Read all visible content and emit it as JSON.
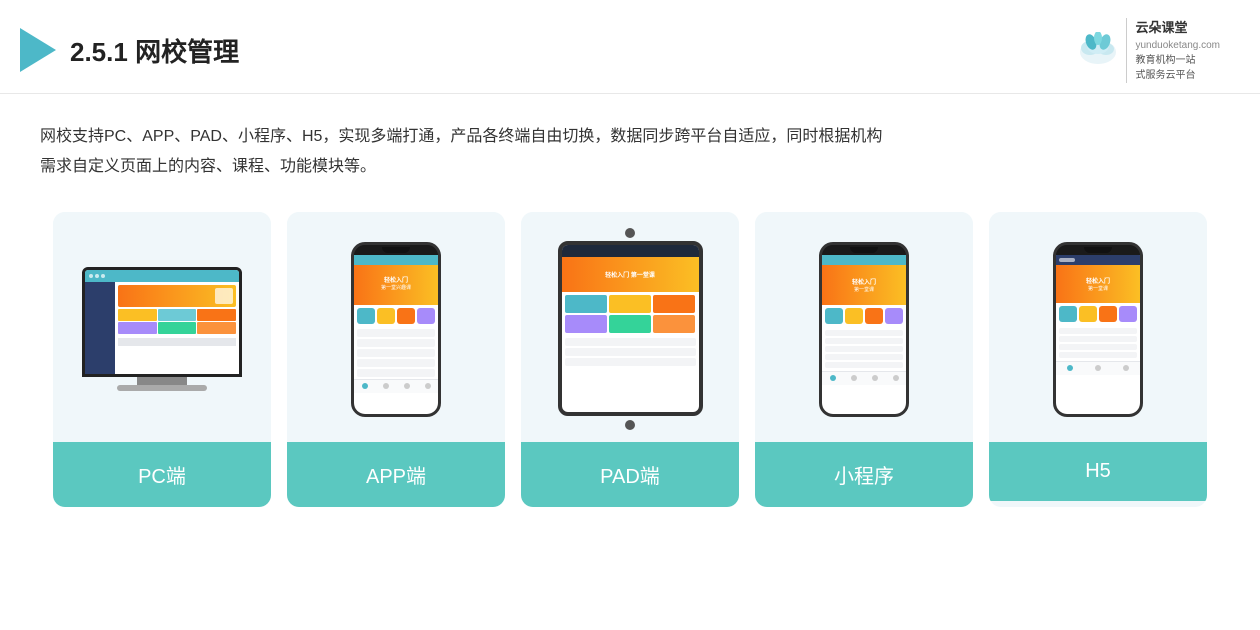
{
  "header": {
    "title_prefix": "2.5.1 ",
    "title_bold": "网校管理",
    "brand_name": "云朵课堂",
    "brand_url": "yunduoketang.com",
    "brand_slogan_line1": "教育机构一站",
    "brand_slogan_line2": "式服务云平台"
  },
  "description": {
    "line1": "网校支持PC、APP、PAD、小程序、H5，实现多端打通，产品各终端自由切换，数据同步跨平台自适应，同时根据机构",
    "line2": "需求自定义页面上的内容、课程、功能模块等。"
  },
  "cards": [
    {
      "id": "pc",
      "label": "PC端"
    },
    {
      "id": "app",
      "label": "APP端"
    },
    {
      "id": "pad",
      "label": "PAD端"
    },
    {
      "id": "miniprogram",
      "label": "小程序"
    },
    {
      "id": "h5",
      "label": "H5"
    }
  ],
  "colors": {
    "teal": "#5bc8c0",
    "dark_blue": "#2c3e6b",
    "orange": "#f97316",
    "yellow": "#fbbf24",
    "accent": "#4db8c8"
  }
}
